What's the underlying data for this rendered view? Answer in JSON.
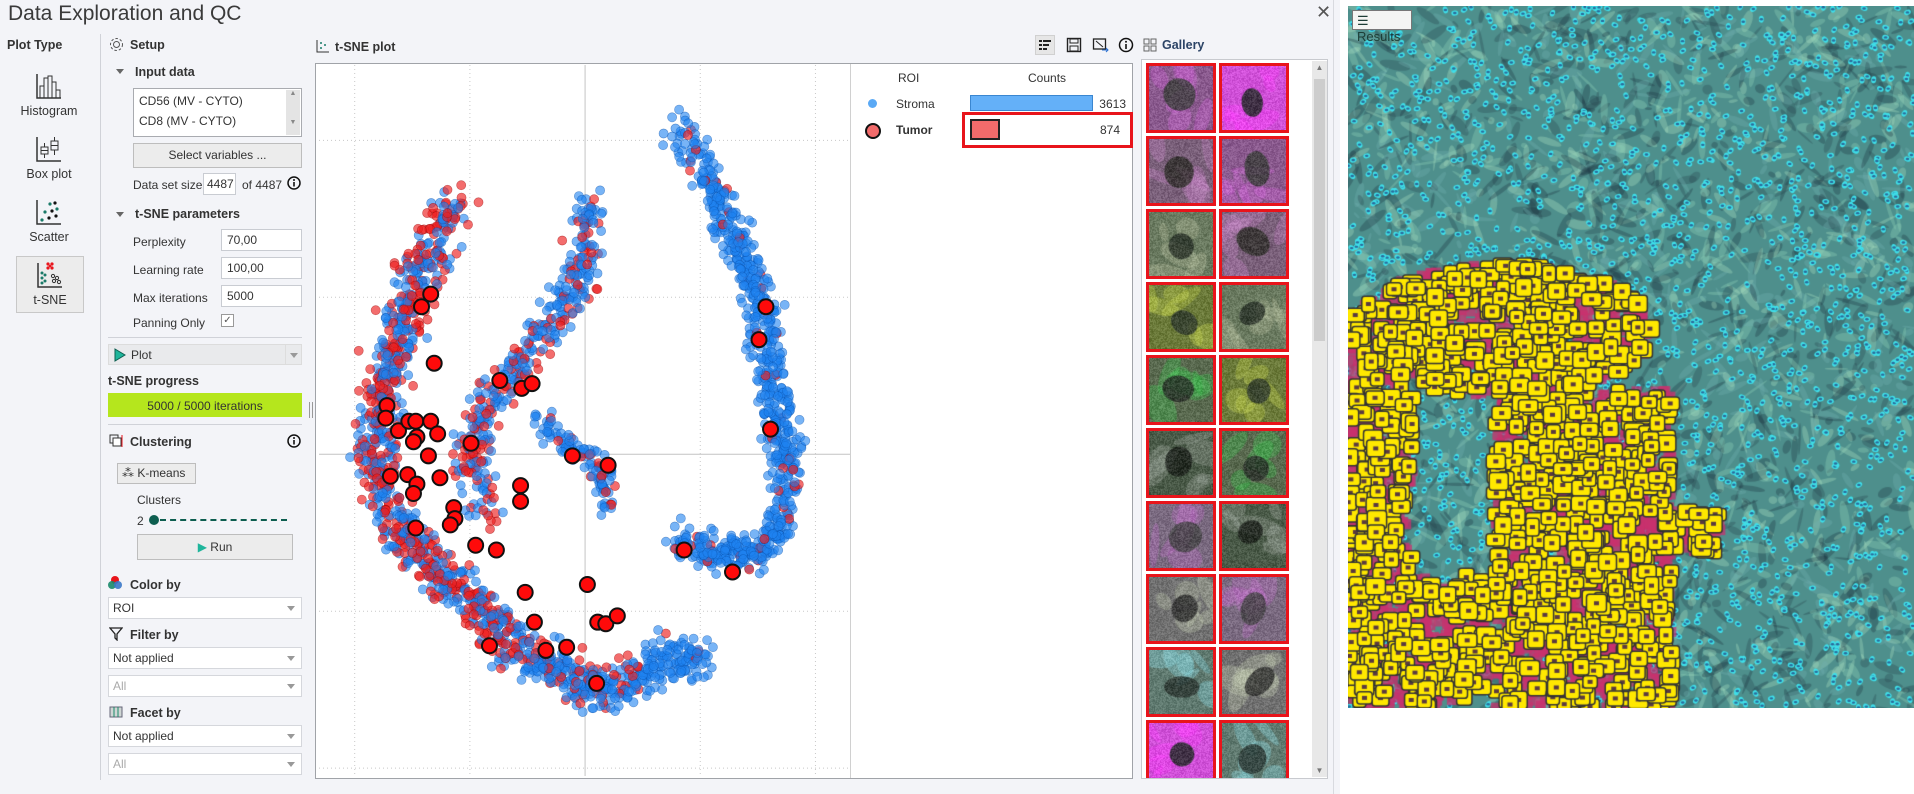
{
  "window": {
    "title": "Data Exploration and QC",
    "close_icon": "close-icon"
  },
  "plot_type": {
    "heading": "Plot Type",
    "items": [
      {
        "label": "Histogram",
        "icon": "histogram-icon"
      },
      {
        "label": "Box plot",
        "icon": "box-plot-icon"
      },
      {
        "label": "Scatter",
        "icon": "scatter-icon"
      },
      {
        "label": "t-SNE",
        "icon": "tsne-icon"
      }
    ],
    "selected": "t-SNE"
  },
  "setup": {
    "heading": "Setup",
    "input_data": {
      "heading": "Input data",
      "variables": [
        "CD56 (MV - CYTO)",
        "CD8 (MV - CYTO)"
      ],
      "select_button": "Select variables ...",
      "dataset_label": "Data set size",
      "dataset_value": "4487",
      "dataset_total": "of 4487"
    },
    "tsne": {
      "heading": "t-SNE parameters",
      "perplexity_label": "Perplexity",
      "perplexity": "70,00",
      "lr_label": "Learning rate",
      "lr": "100,00",
      "iter_label": "Max iterations",
      "iter": "5000",
      "panning_label": "Panning Only",
      "panning_checked": true
    },
    "plot_button": "Plot",
    "progress": {
      "label": "t-SNE progress",
      "text": "5000 / 5000 iterations",
      "value": 5000,
      "max": 5000,
      "color": "#b5e61d"
    },
    "clustering": {
      "heading": "Clustering",
      "kmeans": "K-means",
      "clusters_label": "Clusters",
      "clusters": "2",
      "run": "Run"
    },
    "color_by": {
      "heading": "Color by",
      "value": "ROI"
    },
    "filter_by": {
      "heading": "Filter by",
      "value": "Not applied",
      "sub": "All"
    },
    "facet_by": {
      "heading": "Facet by",
      "value": "Not applied",
      "sub": "All"
    }
  },
  "plot": {
    "title": "t-SNE plot",
    "toolbar": [
      "legend-icon",
      "save-icon",
      "export-icon",
      "info-icon"
    ]
  },
  "gallery": {
    "title": "Gallery",
    "thumbnail_count": 20
  },
  "results": {
    "label": "Results"
  },
  "chart_data": {
    "type": "scatter",
    "title": "",
    "xlabel": "",
    "ylabel": "",
    "xlim": [
      -23.1,
      23.0
    ],
    "ylim": [
      -20.5,
      24.8
    ],
    "grid": true,
    "legend": {
      "title": "ROI",
      "counts_header": "Counts",
      "placement": "right",
      "entries": [
        {
          "name": "Stroma",
          "count": 3613,
          "color": "#5aa9f5"
        },
        {
          "name": "Tumor",
          "count": 874,
          "color": "#f26b6b",
          "selected": true
        }
      ]
    },
    "series": [
      {
        "name": "Stroma",
        "color": "#1e82f0",
        "count": 3613
      },
      {
        "name": "Tumor",
        "color": "#e81e1e",
        "count": 874
      }
    ],
    "highlighted_tumor_points": [
      [
        -13.4,
        10.2
      ],
      [
        -14.2,
        9.4
      ],
      [
        -13.1,
        5.8
      ],
      [
        -7.4,
        4.7
      ],
      [
        -5.5,
        4.2
      ],
      [
        -4.6,
        4.5
      ],
      [
        -17.2,
        3.1
      ],
      [
        -17.3,
        2.3
      ],
      [
        -16.2,
        1.5
      ],
      [
        -15.3,
        2.1
      ],
      [
        -14.7,
        2.1
      ],
      [
        -13.4,
        2.1
      ],
      [
        -12.8,
        1.3
      ],
      [
        -14.6,
        1.1
      ],
      [
        -14.9,
        0.8
      ],
      [
        -13.6,
        -0.1
      ],
      [
        -9.9,
        0.7
      ],
      [
        -1.1,
        -0.1
      ],
      [
        2.0,
        -0.7
      ],
      [
        -16.9,
        -1.4
      ],
      [
        -15.4,
        -1.3
      ],
      [
        -14.6,
        -1.9
      ],
      [
        -14.9,
        -2.5
      ],
      [
        -12.6,
        -1.5
      ],
      [
        -5.6,
        -2.0
      ],
      [
        -5.6,
        -3.0
      ],
      [
        -11.4,
        -3.4
      ],
      [
        -11.3,
        -4.1
      ],
      [
        -11.7,
        -4.5
      ],
      [
        -14.7,
        -4.7
      ],
      [
        -9.5,
        -5.8
      ],
      [
        -7.7,
        -6.1
      ],
      [
        15.7,
        9.4
      ],
      [
        15.1,
        7.3
      ],
      [
        16.1,
        1.6
      ],
      [
        8.6,
        -6.1
      ],
      [
        12.8,
        -7.5
      ],
      [
        0.2,
        -8.3
      ],
      [
        -5.2,
        -8.8
      ],
      [
        -4.4,
        -10.7
      ],
      [
        1.1,
        -10.7
      ],
      [
        1.8,
        -10.8
      ],
      [
        2.8,
        -10.3
      ],
      [
        -8.3,
        -12.2
      ],
      [
        -3.4,
        -12.5
      ],
      [
        -1.6,
        -12.3
      ],
      [
        1.0,
        -14.6
      ]
    ]
  }
}
